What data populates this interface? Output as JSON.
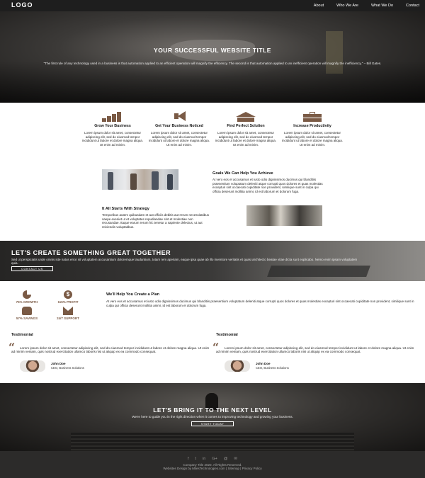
{
  "nav": {
    "logo": "LOGO",
    "links": [
      "About",
      "Who We Are",
      "What We Do",
      "Contact"
    ]
  },
  "hero": {
    "title": "YOUR SUCCESSFUL WEBSITE TITLE",
    "quote": "\"The first rule of any technology used in a business is that automation applied to an efficient operation will magnify the efficiency. The second is that automation applied to an inefficient operation will magnify the inefficiency.\" – Bill Gates."
  },
  "features": [
    {
      "icon": "bar-chart-icon",
      "title": "Grow Your Business",
      "text": "Lorem ipsum dolor sit amet, consectetur adipiscing elit, sed do eiusmod tempor incididunt ut labore et dolore magna aliqua. Ut enim ad minim."
    },
    {
      "icon": "megaphone-icon",
      "title": "Get Your Business Noticed",
      "text": "Lorem ipsum dolor sit amet, consectetur adipiscing elit, sed do eiusmod tempor incididunt ut labore et dolore magna aliqua. Ut enim ad minim."
    },
    {
      "icon": "house-icon",
      "title": "Find Perfect Solution",
      "text": "Lorem ipsum dolor sit amet, consectetur adipiscing elit, sed do eiusmod tempor incididunt ut labore et dolore magna aliqua. Ut enim ad minim."
    },
    {
      "icon": "briefcase-icon",
      "title": "Increase Productivity",
      "text": "Lorem ipsum dolor sit amet, consectetur adipiscing elit, sed do eiusmod tempor incididunt ut labore et dolore magna aliqua. Ut enim ad minim."
    }
  ],
  "goals": {
    "title": "Goals We Can Help You Achieve",
    "text": "At vero eos et accusamus et iusto odio dignissimos ducimus qui blanditiis praesentium voluptatum deleniti atque corrupti quos dolores et quas molestias excepturi sint occaecati cupiditate non provident, similique sunt in culpa qui officia deserunt mollitia animi, id est laborum et dolorum fuga."
  },
  "strategy": {
    "title": "It All Starts With Strategy",
    "text": "Temporibus autem quibusdam et aut officiis debitis aut rerum necessitatibus saepe eveniet ut et voluptates repudiandae sint et molestiae non recusandae. Itaque earum rerum hic tenetur a sapiente delectus, ut aut reiciendis voluptatibus."
  },
  "banner": {
    "title": "LET'S CREATE SOMETHING GREAT TOGETHER",
    "text": "Sed ut perspiciatis unde omnis iste natus error sit voluptatem accusantium doloremque laudantium, totam rem aperiam, eaque ipsa quae ab illo inventore veritatis et quasi architecto beatae vitae dicta sunt explicabo. Nemo enim ipsam voluptatem quia.",
    "button": "CONTACT US"
  },
  "stats": [
    {
      "icon": "pie-chart-icon",
      "label": "75% GROWTH"
    },
    {
      "icon": "coin-icon",
      "label": "115% PROFIT"
    },
    {
      "icon": "piggy-bank-icon",
      "label": "57% SAVINGS"
    },
    {
      "icon": "envelope-icon",
      "label": "24/7 SUPPORT"
    }
  ],
  "plan": {
    "title": "We'll Help You Create a Plan",
    "text": "At vero eos et accusamus et iusto odio dignissimos ducimus qui blanditiis praesentium voluptatum deleniti atque corrupti quos dolores et quas molestias excepturi sint occaecati cupiditate non provident, similique sunt in culpa qui officia deserunt mollitia animi, id est laborum et dolorum fuga."
  },
  "testimonials": [
    {
      "heading": "Testimonial",
      "text": "Lorem ipsum dolor sit amet, consectetur adipiscing elit, sed do eiusmod tempor incididunt ut labore et dolore magna aliqua. Ut enim ad minim veniam, quis nostrud exercitation ullamco laboris nisi ut aliquip ex ea commodo consequat.",
      "name": "John Doe",
      "role": "CEO, Business Solutions"
    },
    {
      "heading": "Testimonial",
      "text": "Lorem ipsum dolor sit amet, consectetur adipiscing elit, sed do eiusmod tempor incididunt ut labore et dolore magna aliqua. Ut enim ad minim veniam, quis nostrud exercitation ullamco laboris nisi ut aliquip ex ea commodo consequat.",
      "name": "John Doe",
      "role": "CEO, Business Solutions"
    }
  ],
  "cta": {
    "title": "LET'S BRING IT TO THE NEXT LEVEL",
    "text": "We're here to guide you in the right direction when it comes to improving technology and growing your business.",
    "button": "START TODAY"
  },
  "footer": {
    "social": [
      "f",
      "t",
      "in",
      "G+",
      "@",
      "✉"
    ],
    "copyright": "Company Title 2020. All Rights Reserved.",
    "credits": "Websites Design by MilesTechnologies.com | Sitemap | Privacy Policy"
  }
}
